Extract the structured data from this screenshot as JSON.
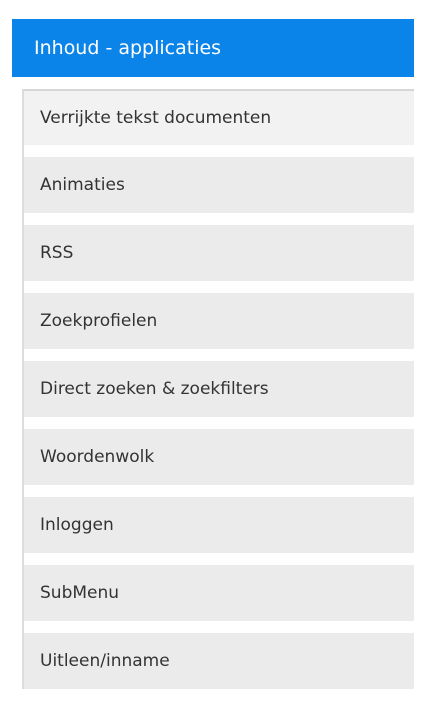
{
  "header": {
    "title": "Inhoud - applicaties"
  },
  "menu": {
    "items": [
      {
        "label": "Verrijkte tekst documenten",
        "active": true
      },
      {
        "label": "Animaties"
      },
      {
        "label": "RSS"
      },
      {
        "label": "Zoekprofielen"
      },
      {
        "label": "Direct zoeken & zoekfilters"
      },
      {
        "label": "Woordenwolk"
      },
      {
        "label": "Inloggen"
      },
      {
        "label": "SubMenu"
      },
      {
        "label": "Uitleen/inname"
      }
    ]
  },
  "colors": {
    "header_bg": "#0b84e9",
    "item_bg": "#ebebeb",
    "text": "#333333"
  }
}
